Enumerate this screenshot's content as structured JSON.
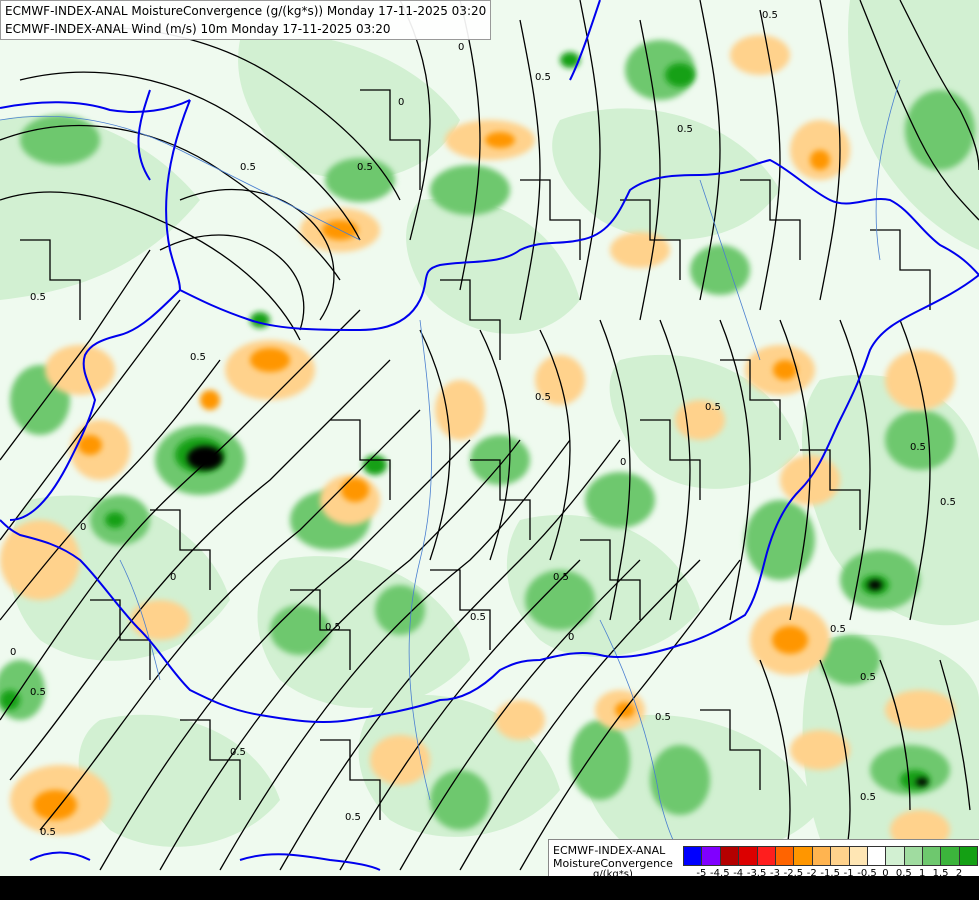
{
  "titles": {
    "line1": "ECMWF-INDEX-ANAL MoistureConvergence (g/(kg*s)) Monday 17-11-2025 03:20",
    "line2": "ECMWF-INDEX-ANAL Wind (m/s) 10m Monday 17-11-2025 03:20"
  },
  "legend": {
    "line1": "ECMWF-INDEX-ANAL",
    "line2": "MoistureConvergence",
    "unit": "g/(kg*s)",
    "colors": [
      "#0000ff",
      "#8000ff",
      "#b40000",
      "#dc0000",
      "#ff1e1e",
      "#ff6400",
      "#ff9600",
      "#ffb450",
      "#ffd28c",
      "#ffe6b4",
      "#ffffff",
      "#d2f0d2",
      "#a0dca0",
      "#6ec86e",
      "#3cb43c",
      "#14a014"
    ],
    "ticks": [
      "-5",
      "-4.5",
      "-4",
      "-3.5",
      "-3",
      "-2.5",
      "-2",
      "-1.5",
      "-1",
      "-0.5",
      "0",
      "0.5",
      "1",
      "1.5",
      "2"
    ]
  },
  "contour_labels": [
    "0.5",
    "0",
    "0",
    "0.5",
    "0.5",
    "0.5",
    "0.5",
    "0.5",
    "0.5",
    "0",
    "0.5",
    "0.5",
    "0.5",
    "0",
    "0",
    "0.5",
    "0.5",
    "0.5",
    "0",
    "0.5",
    "0.5",
    "0",
    "0.5",
    "0.5",
    "0.5",
    "0.5",
    "0.5",
    "0.5",
    "0.5"
  ]
}
